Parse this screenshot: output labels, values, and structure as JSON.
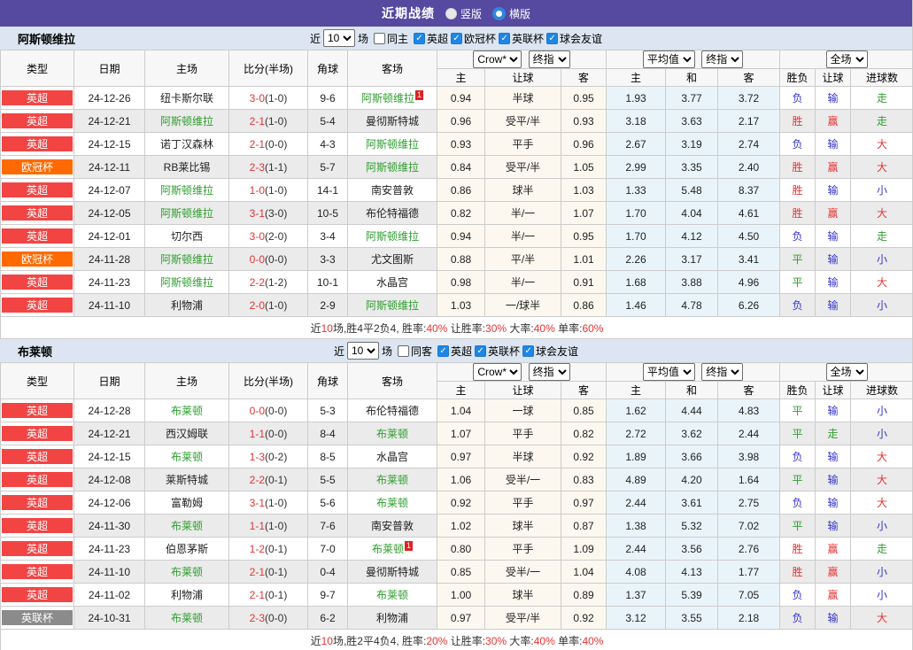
{
  "topbar": {
    "title": "近期战绩",
    "radios": [
      {
        "label": "竖版",
        "checked": false
      },
      {
        "label": "横版",
        "checked": true
      }
    ]
  },
  "colors": {
    "accent_purple": "#5549a0",
    "section_bar_bg": "#dce5f1",
    "league_epl_red": "#f34444",
    "league_ucl_orange": "#ff6a00",
    "league_efl_gray": "#8b8b8b",
    "featured_team_green": "#2e9e2e",
    "score_red": "#e53333",
    "lose_blue": "#3333cc",
    "crow_col_bg": "#fcf8ef",
    "avg_col_bg": "#e9f4fa",
    "checkbox_blue": "#1e87e5"
  },
  "table_header": {
    "type": "类型",
    "date": "日期",
    "home": "主场",
    "score": "比分(半场)",
    "corner": "角球",
    "away": "客场",
    "group1_select1": "Crow*",
    "group1_select2": "终指",
    "group1_cols": [
      "主",
      "让球",
      "客"
    ],
    "group2_select1": "平均值",
    "group2_select2": "终指",
    "group2_cols": [
      "主",
      "和",
      "客"
    ],
    "group3_select": "全场",
    "group3_cols": [
      "胜负",
      "让球",
      "进球数"
    ]
  },
  "sections": [
    {
      "team": "阿斯顿维拉",
      "filter": {
        "near": "近",
        "count": "10",
        "games": "场",
        "same": {
          "label": "同主",
          "checked": false
        },
        "leagues": [
          {
            "label": "英超",
            "checked": true
          },
          {
            "label": "欧冠杯",
            "checked": true
          },
          {
            "label": "英联杯",
            "checked": true
          },
          {
            "label": "球会友谊",
            "checked": true
          }
        ]
      },
      "rows": [
        {
          "league": "英超",
          "league_color": "epl",
          "date": "24-12-26",
          "home": "纽卡斯尔联",
          "home_featured": false,
          "ft": "3-0",
          "ht": "(1-0)",
          "corner": "9-6",
          "away": "阿斯顿维拉",
          "away_featured": true,
          "away_sup": "1",
          "crow": [
            "0.94",
            "半球",
            "0.95"
          ],
          "avg": [
            "1.93",
            "3.77",
            "3.72"
          ],
          "results": [
            {
              "text": "负",
              "color": "b"
            },
            {
              "text": "输",
              "color": "b"
            },
            {
              "text": "走",
              "color": "g"
            }
          ]
        },
        {
          "league": "英超",
          "league_color": "epl",
          "date": "24-12-21",
          "home": "阿斯顿维拉",
          "home_featured": true,
          "ft": "2-1",
          "ht": "(1-0)",
          "corner": "5-4",
          "away": "曼彻斯特城",
          "away_featured": false,
          "crow": [
            "0.96",
            "受平/半",
            "0.93"
          ],
          "avg": [
            "3.18",
            "3.63",
            "2.17"
          ],
          "results": [
            {
              "text": "胜",
              "color": "r"
            },
            {
              "text": "赢",
              "color": "r"
            },
            {
              "text": "走",
              "color": "g"
            }
          ]
        },
        {
          "league": "英超",
          "league_color": "epl",
          "date": "24-12-15",
          "home": "诺丁汉森林",
          "home_featured": false,
          "ft": "2-1",
          "ht": "(0-0)",
          "corner": "4-3",
          "away": "阿斯顿维拉",
          "away_featured": true,
          "crow": [
            "0.93",
            "平手",
            "0.96"
          ],
          "avg": [
            "2.67",
            "3.19",
            "2.74"
          ],
          "results": [
            {
              "text": "负",
              "color": "b"
            },
            {
              "text": "输",
              "color": "b"
            },
            {
              "text": "大",
              "color": "r"
            }
          ]
        },
        {
          "league": "欧冠杯",
          "league_color": "ucl",
          "date": "24-12-11",
          "home": "RB莱比锡",
          "home_featured": false,
          "ft": "2-3",
          "ht": "(1-1)",
          "corner": "5-7",
          "away": "阿斯顿维拉",
          "away_featured": true,
          "crow": [
            "0.84",
            "受平/半",
            "1.05"
          ],
          "avg": [
            "2.99",
            "3.35",
            "2.40"
          ],
          "results": [
            {
              "text": "胜",
              "color": "r"
            },
            {
              "text": "赢",
              "color": "r"
            },
            {
              "text": "大",
              "color": "r"
            }
          ]
        },
        {
          "league": "英超",
          "league_color": "epl",
          "date": "24-12-07",
          "home": "阿斯顿维拉",
          "home_featured": true,
          "ft": "1-0",
          "ht": "(1-0)",
          "corner": "14-1",
          "away": "南安普敦",
          "away_featured": false,
          "crow": [
            "0.86",
            "球半",
            "1.03"
          ],
          "avg": [
            "1.33",
            "5.48",
            "8.37"
          ],
          "results": [
            {
              "text": "胜",
              "color": "r"
            },
            {
              "text": "输",
              "color": "b"
            },
            {
              "text": "小",
              "color": "b"
            }
          ]
        },
        {
          "league": "英超",
          "league_color": "epl",
          "date": "24-12-05",
          "home": "阿斯顿维拉",
          "home_featured": true,
          "ft": "3-1",
          "ht": "(3-0)",
          "corner": "10-5",
          "away": "布伦特福德",
          "away_featured": false,
          "crow": [
            "0.82",
            "半/一",
            "1.07"
          ],
          "avg": [
            "1.70",
            "4.04",
            "4.61"
          ],
          "results": [
            {
              "text": "胜",
              "color": "r"
            },
            {
              "text": "赢",
              "color": "r"
            },
            {
              "text": "大",
              "color": "r"
            }
          ]
        },
        {
          "league": "英超",
          "league_color": "epl",
          "date": "24-12-01",
          "home": "切尔西",
          "home_featured": false,
          "ft": "3-0",
          "ht": "(2-0)",
          "corner": "3-4",
          "away": "阿斯顿维拉",
          "away_featured": true,
          "crow": [
            "0.94",
            "半/一",
            "0.95"
          ],
          "avg": [
            "1.70",
            "4.12",
            "4.50"
          ],
          "results": [
            {
              "text": "负",
              "color": "b"
            },
            {
              "text": "输",
              "color": "b"
            },
            {
              "text": "走",
              "color": "g"
            }
          ]
        },
        {
          "league": "欧冠杯",
          "league_color": "ucl",
          "date": "24-11-28",
          "home": "阿斯顿维拉",
          "home_featured": true,
          "ft": "0-0",
          "ht": "(0-0)",
          "corner": "3-3",
          "away": "尤文图斯",
          "away_featured": false,
          "crow": [
            "0.88",
            "平/半",
            "1.01"
          ],
          "avg": [
            "2.26",
            "3.17",
            "3.41"
          ],
          "results": [
            {
              "text": "平",
              "color": "g"
            },
            {
              "text": "输",
              "color": "b"
            },
            {
              "text": "小",
              "color": "b"
            }
          ]
        },
        {
          "league": "英超",
          "league_color": "epl",
          "date": "24-11-23",
          "home": "阿斯顿维拉",
          "home_featured": true,
          "ft": "2-2",
          "ht": "(1-2)",
          "corner": "10-1",
          "away": "水晶宫",
          "away_featured": false,
          "crow": [
            "0.98",
            "半/一",
            "0.91"
          ],
          "avg": [
            "1.68",
            "3.88",
            "4.96"
          ],
          "results": [
            {
              "text": "平",
              "color": "g"
            },
            {
              "text": "输",
              "color": "b"
            },
            {
              "text": "大",
              "color": "r"
            }
          ]
        },
        {
          "league": "英超",
          "league_color": "epl",
          "date": "24-11-10",
          "home": "利物浦",
          "home_featured": false,
          "ft": "2-0",
          "ht": "(1-0)",
          "corner": "2-9",
          "away": "阿斯顿维拉",
          "away_featured": true,
          "crow": [
            "1.03",
            "一/球半",
            "0.86"
          ],
          "avg": [
            "1.46",
            "4.78",
            "6.26"
          ],
          "results": [
            {
              "text": "负",
              "color": "b"
            },
            {
              "text": "输",
              "color": "b"
            },
            {
              "text": "小",
              "color": "b"
            }
          ]
        }
      ],
      "summary": [
        {
          "text": "近",
          "red": false
        },
        {
          "text": "10",
          "red": true
        },
        {
          "text": "场,胜4平2负4, 胜率:",
          "red": false
        },
        {
          "text": "40%",
          "red": true
        },
        {
          "text": " 让胜率:",
          "red": false
        },
        {
          "text": "30%",
          "red": true
        },
        {
          "text": " 大率:",
          "red": false
        },
        {
          "text": "40%",
          "red": true
        },
        {
          "text": " 单率:",
          "red": false
        },
        {
          "text": "60%",
          "red": true
        }
      ]
    },
    {
      "team": "布莱顿",
      "filter": {
        "near": "近",
        "count": "10",
        "games": "场",
        "same": {
          "label": "同客",
          "checked": false
        },
        "leagues": [
          {
            "label": "英超",
            "checked": true
          },
          {
            "label": "英联杯",
            "checked": true
          },
          {
            "label": "球会友谊",
            "checked": true
          }
        ]
      },
      "rows": [
        {
          "league": "英超",
          "league_color": "epl",
          "date": "24-12-28",
          "home": "布莱顿",
          "home_featured": true,
          "ft": "0-0",
          "ht": "(0-0)",
          "corner": "5-3",
          "away": "布伦特福德",
          "away_featured": false,
          "crow": [
            "1.04",
            "一球",
            "0.85"
          ],
          "avg": [
            "1.62",
            "4.44",
            "4.83"
          ],
          "results": [
            {
              "text": "平",
              "color": "g"
            },
            {
              "text": "输",
              "color": "b"
            },
            {
              "text": "小",
              "color": "b"
            }
          ]
        },
        {
          "league": "英超",
          "league_color": "epl",
          "date": "24-12-21",
          "home": "西汉姆联",
          "home_featured": false,
          "ft": "1-1",
          "ht": "(0-0)",
          "corner": "8-4",
          "away": "布莱顿",
          "away_featured": true,
          "crow": [
            "1.07",
            "平手",
            "0.82"
          ],
          "avg": [
            "2.72",
            "3.62",
            "2.44"
          ],
          "results": [
            {
              "text": "平",
              "color": "g"
            },
            {
              "text": "走",
              "color": "g"
            },
            {
              "text": "小",
              "color": "b"
            }
          ]
        },
        {
          "league": "英超",
          "league_color": "epl",
          "date": "24-12-15",
          "home": "布莱顿",
          "home_featured": true,
          "ft": "1-3",
          "ht": "(0-2)",
          "corner": "8-5",
          "away": "水晶宫",
          "away_featured": false,
          "crow": [
            "0.97",
            "半球",
            "0.92"
          ],
          "avg": [
            "1.89",
            "3.66",
            "3.98"
          ],
          "results": [
            {
              "text": "负",
              "color": "b"
            },
            {
              "text": "输",
              "color": "b"
            },
            {
              "text": "大",
              "color": "r"
            }
          ]
        },
        {
          "league": "英超",
          "league_color": "epl",
          "date": "24-12-08",
          "home": "莱斯特城",
          "home_featured": false,
          "ft": "2-2",
          "ht": "(0-1)",
          "corner": "5-5",
          "away": "布莱顿",
          "away_featured": true,
          "crow": [
            "1.06",
            "受半/一",
            "0.83"
          ],
          "avg": [
            "4.89",
            "4.20",
            "1.64"
          ],
          "results": [
            {
              "text": "平",
              "color": "g"
            },
            {
              "text": "输",
              "color": "b"
            },
            {
              "text": "大",
              "color": "r"
            }
          ]
        },
        {
          "league": "英超",
          "league_color": "epl",
          "date": "24-12-06",
          "home": "富勒姆",
          "home_featured": false,
          "ft": "3-1",
          "ht": "(1-0)",
          "corner": "5-6",
          "away": "布莱顿",
          "away_featured": true,
          "crow": [
            "0.92",
            "平手",
            "0.97"
          ],
          "avg": [
            "2.44",
            "3.61",
            "2.75"
          ],
          "results": [
            {
              "text": "负",
              "color": "b"
            },
            {
              "text": "输",
              "color": "b"
            },
            {
              "text": "大",
              "color": "r"
            }
          ]
        },
        {
          "league": "英超",
          "league_color": "epl",
          "date": "24-11-30",
          "home": "布莱顿",
          "home_featured": true,
          "ft": "1-1",
          "ht": "(1-0)",
          "corner": "7-6",
          "away": "南安普敦",
          "away_featured": false,
          "crow": [
            "1.02",
            "球半",
            "0.87"
          ],
          "avg": [
            "1.38",
            "5.32",
            "7.02"
          ],
          "results": [
            {
              "text": "平",
              "color": "g"
            },
            {
              "text": "输",
              "color": "b"
            },
            {
              "text": "小",
              "color": "b"
            }
          ]
        },
        {
          "league": "英超",
          "league_color": "epl",
          "date": "24-11-23",
          "home": "伯恩茅斯",
          "home_featured": false,
          "ft": "1-2",
          "ht": "(0-1)",
          "corner": "7-0",
          "away": "布莱顿",
          "away_featured": true,
          "away_sup": "1",
          "crow": [
            "0.80",
            "平手",
            "1.09"
          ],
          "avg": [
            "2.44",
            "3.56",
            "2.76"
          ],
          "results": [
            {
              "text": "胜",
              "color": "r"
            },
            {
              "text": "赢",
              "color": "r"
            },
            {
              "text": "走",
              "color": "g"
            }
          ]
        },
        {
          "league": "英超",
          "league_color": "epl",
          "date": "24-11-10",
          "home": "布莱顿",
          "home_featured": true,
          "ft": "2-1",
          "ht": "(0-1)",
          "corner": "0-4",
          "away": "曼彻斯特城",
          "away_featured": false,
          "crow": [
            "0.85",
            "受半/一",
            "1.04"
          ],
          "avg": [
            "4.08",
            "4.13",
            "1.77"
          ],
          "results": [
            {
              "text": "胜",
              "color": "r"
            },
            {
              "text": "赢",
              "color": "r"
            },
            {
              "text": "小",
              "color": "b"
            }
          ]
        },
        {
          "league": "英超",
          "league_color": "epl",
          "date": "24-11-02",
          "home": "利物浦",
          "home_featured": false,
          "ft": "2-1",
          "ht": "(0-1)",
          "corner": "9-7",
          "away": "布莱顿",
          "away_featured": true,
          "crow": [
            "1.00",
            "球半",
            "0.89"
          ],
          "avg": [
            "1.37",
            "5.39",
            "7.05"
          ],
          "results": [
            {
              "text": "负",
              "color": "b"
            },
            {
              "text": "赢",
              "color": "r"
            },
            {
              "text": "小",
              "color": "b"
            }
          ]
        },
        {
          "league": "英联杯",
          "league_color": "efl",
          "date": "24-10-31",
          "home": "布莱顿",
          "home_featured": true,
          "ft": "2-3",
          "ht": "(0-0)",
          "corner": "6-2",
          "away": "利物浦",
          "away_featured": false,
          "crow": [
            "0.97",
            "受平/半",
            "0.92"
          ],
          "avg": [
            "3.12",
            "3.55",
            "2.18"
          ],
          "results": [
            {
              "text": "负",
              "color": "b"
            },
            {
              "text": "输",
              "color": "b"
            },
            {
              "text": "大",
              "color": "r"
            }
          ]
        }
      ],
      "summary": [
        {
          "text": "近",
          "red": false
        },
        {
          "text": "10",
          "red": true
        },
        {
          "text": "场,胜2平4负4, 胜率:",
          "red": false
        },
        {
          "text": "20%",
          "red": true
        },
        {
          "text": " 让胜率:",
          "red": false
        },
        {
          "text": "30%",
          "red": true
        },
        {
          "text": " 大率:",
          "red": false
        },
        {
          "text": "40%",
          "red": true
        },
        {
          "text": " 单率:",
          "red": false
        },
        {
          "text": "40%",
          "red": true
        }
      ]
    }
  ]
}
